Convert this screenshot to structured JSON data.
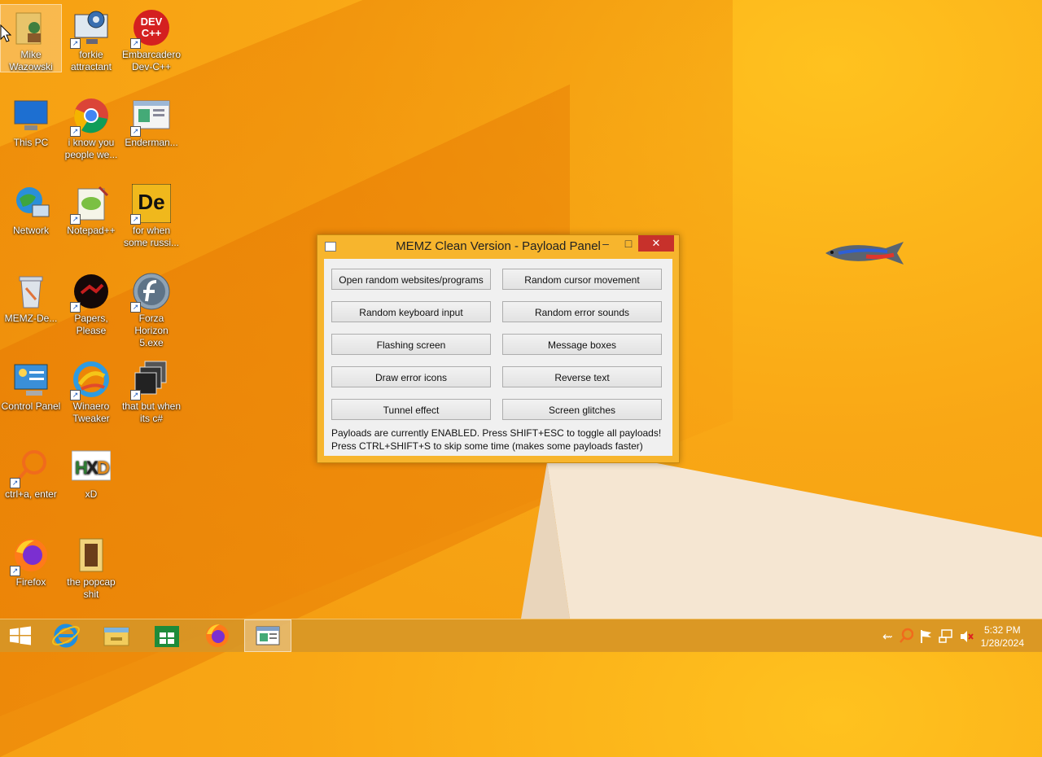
{
  "desktop_icons": [
    {
      "label": "Mike Wazowski",
      "icon": "folder-person-icon"
    },
    {
      "label": "forkie attractant",
      "icon": "computer-gear-icon"
    },
    {
      "label": "Embarcadero Dev-C++",
      "icon": "devcpp-icon",
      "badge": "DEV C++"
    },
    {
      "label": "This PC",
      "icon": "computer-icon"
    },
    {
      "label": "i know you people we...",
      "icon": "chrome-icon"
    },
    {
      "label": "Enderman...",
      "icon": "window-app-icon"
    },
    {
      "label": "Network",
      "icon": "network-globe-icon"
    },
    {
      "label": "Notepad++",
      "icon": "notepadpp-icon"
    },
    {
      "label": "for when some russi...",
      "icon": "de-app-icon",
      "badge": "De"
    },
    {
      "label": "MEMZ-De...",
      "icon": "recycle-bin-icon"
    },
    {
      "label": "Papers, Please",
      "icon": "papers-please-icon"
    },
    {
      "label": "Forza Horizon 5.exe",
      "icon": "flash-icon"
    },
    {
      "label": "Control Panel",
      "icon": "control-panel-icon"
    },
    {
      "label": "Winaero Tweaker",
      "icon": "winaero-icon"
    },
    {
      "label": "that but when its c#",
      "icon": "windows-stack-icon"
    },
    {
      "label": "ctrl+a, enter",
      "icon": "magnifier-icon"
    },
    {
      "label": "xD",
      "icon": "hxd-icon",
      "badge": "HXD"
    },
    {
      "label": "Firefox",
      "icon": "firefox-icon"
    },
    {
      "label": "the popcap shit",
      "icon": "popcap-folder-icon"
    }
  ],
  "window": {
    "title": "MEMZ Clean Version - Payload Panel",
    "minimize": "–",
    "maximize": "□",
    "close": "✕",
    "buttons": [
      "Open random websites/programs",
      "Random cursor movement",
      "Random keyboard input",
      "Random error sounds",
      "Flashing screen",
      "Message boxes",
      "Draw error icons",
      "Reverse text",
      "Tunnel effect",
      "Screen glitches"
    ],
    "status_line_1": "Payloads are currently ENABLED. Press SHIFT+ESC to toggle all payloads!",
    "status_line_2": "Press CTRL+SHIFT+S to skip some time (makes some payloads faster)"
  },
  "taskbar": {
    "items": [
      "start-icon",
      "internet-explorer-icon",
      "file-explorer-icon",
      "store-icon",
      "firefox-icon",
      "memz-window-icon"
    ],
    "active_item": "memz-window-icon",
    "tray_icons": [
      "flag-arrow-icon",
      "magnifier-icon",
      "action-center-flag-icon",
      "network-icon",
      "speaker-muted-icon"
    ],
    "time": "5:32 PM",
    "date": "1/28/2024"
  },
  "colors": {
    "wallpaper": "#f9a715",
    "window_frame": "#f7b52d",
    "close_button": "#c7312b"
  }
}
